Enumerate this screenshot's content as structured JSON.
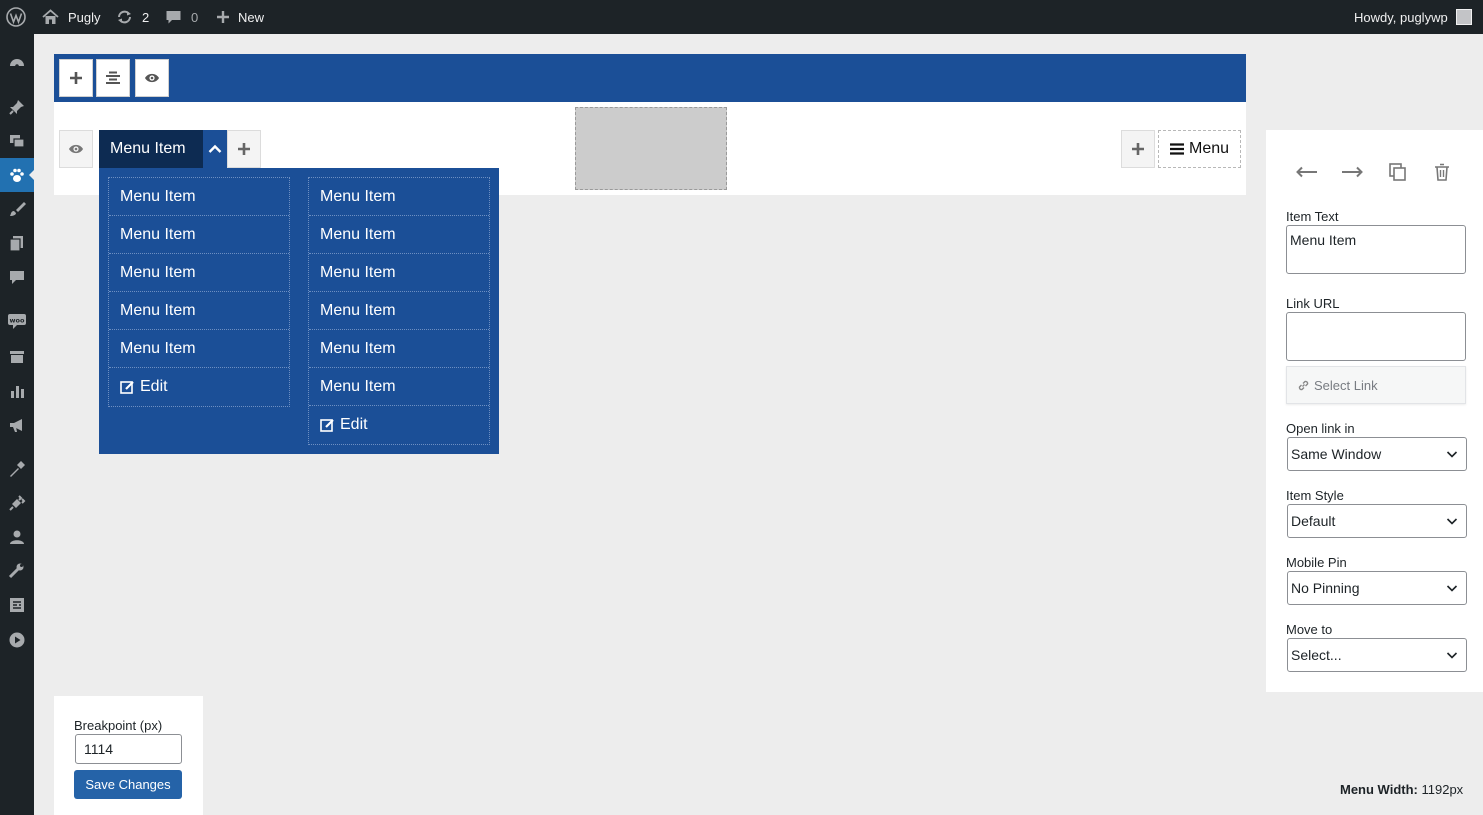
{
  "admin_bar": {
    "site_name": "Pugly",
    "updates_count": "2",
    "comments_count": "0",
    "new_label": "New",
    "howdy": "Howdy, puglywp"
  },
  "sidebar": {
    "icons": [
      "dashboard-icon",
      "pin-icon",
      "media-icon",
      "paw-icon",
      "brush-icon",
      "pages-icon",
      "comments-icon",
      "woo-icon",
      "archive-icon",
      "stats-icon",
      "megaphone-icon",
      "appearance-icon",
      "plugins-icon",
      "users-icon",
      "tools-icon",
      "settings-icon",
      "play-icon"
    ],
    "active": "paw-icon"
  },
  "builder": {
    "top_item_label": "Menu Item",
    "hamburger_label": "Menu",
    "dropdown": {
      "columns": [
        {
          "items": [
            "Menu Item",
            "Menu Item",
            "Menu Item",
            "Menu Item",
            "Menu Item"
          ],
          "edit_label": "Edit"
        },
        {
          "items": [
            "Menu Item",
            "Menu Item",
            "Menu Item",
            "Menu Item",
            "Menu Item",
            "Menu Item"
          ],
          "edit_label": "Edit"
        }
      ]
    }
  },
  "panel": {
    "item_text_label": "Item Text",
    "item_text_value": "Menu Item",
    "link_url_label": "Link URL",
    "link_url_value": "",
    "select_link_label": "Select Link",
    "open_link_label": "Open link in",
    "open_link_value": "Same Window",
    "item_style_label": "Item Style",
    "item_style_value": "Default",
    "mobile_pin_label": "Mobile Pin",
    "mobile_pin_value": "No Pinning",
    "move_to_label": "Move to",
    "move_to_value": "Select..."
  },
  "breakpoint": {
    "label": "Breakpoint (px)",
    "value": "1114",
    "save_label": "Save Changes"
  },
  "footer": {
    "menu_width_label": "Menu Width:",
    "menu_width_value": "1192px"
  },
  "colors": {
    "admin_dark": "#1d2327",
    "builder_blue": "#1b4f97",
    "active_item": "#0d2b52",
    "wp_blue": "#2271b1"
  }
}
